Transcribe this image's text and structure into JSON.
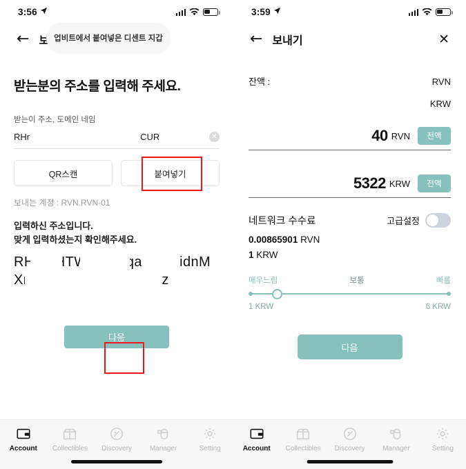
{
  "left": {
    "status": {
      "time": "3:56",
      "location_icon": "location-arrow-icon",
      "signal_icon": "cellular-bars-icon",
      "wifi_icon": "wifi-icon",
      "battery_icon": "battery-icon"
    },
    "nav": {
      "back_icon": "back-arrow-icon",
      "title": "보내기"
    },
    "toast": {
      "text": "업비트에서 붙여넣은 디센트 지갑"
    },
    "heading": "받는분의 주소를 입력해 주세요.",
    "field": {
      "label": "받는이 주소, 도메인 네임",
      "value": "RHr",
      "suffix": "CUR",
      "clear_icon": "clear-circle-icon",
      "clear_glyph": "✕"
    },
    "buttons": {
      "qr_scan": "QR스캔",
      "paste": "붙여넣기"
    },
    "account_line": "보내는 계정 : RVN.RVN-01",
    "confirm_line_1": "입력하신 주소입니다.",
    "confirm_line_2": "맞게 입력하셨는지 확인해주세요.",
    "address_text": "RHr9nHTWyx2SxqaRs34 idnMXrtgnBxvqF2hk?C URvz",
    "next_button": "다음",
    "highlights": [
      "paste-button",
      "next-button"
    ]
  },
  "right": {
    "status": {
      "time": "3:59",
      "location_icon": "location-arrow-icon",
      "signal_icon": "cellular-bars-icon",
      "wifi_icon": "wifi-icon",
      "battery_icon": "battery-icon"
    },
    "nav": {
      "back_icon": "back-arrow-icon",
      "title": "보내기",
      "close_icon": "close-icon",
      "close_glyph": "✕"
    },
    "balance": {
      "label": "잔액 :",
      "coin_value": "",
      "coin_unit": "RVN",
      "fiat_value": "",
      "fiat_unit": "KRW"
    },
    "amount_coin": {
      "value": "40",
      "unit": "RVN",
      "max_button": "전액"
    },
    "amount_fiat": {
      "value": "5322",
      "unit": "KRW",
      "max_button": "전액"
    },
    "fee": {
      "title": "네트워크 수수료",
      "advanced_label": "고급설정",
      "advanced_on": false,
      "coin_value": "0.00865901",
      "coin_unit": "RVN",
      "fiat_value": "1",
      "fiat_unit": "KRW"
    },
    "slider": {
      "label_slow": "매우느림",
      "label_normal": "보통",
      "label_fast": "빠름",
      "value_min": "1 KRW",
      "value_max": "6 KRW",
      "position_percent": 12
    },
    "next_button": "다음"
  },
  "tabbar": {
    "items": [
      {
        "label": "Account",
        "icon": "wallet-icon",
        "active": true
      },
      {
        "label": "Collectibles",
        "icon": "gift-box-icon",
        "active": false
      },
      {
        "label": "Discovery",
        "icon": "compass-icon",
        "active": false
      },
      {
        "label": "Manager",
        "icon": "mouse-icon",
        "active": false
      },
      {
        "label": "Setting",
        "icon": "gear-icon",
        "active": false
      }
    ]
  },
  "colors": {
    "accent_teal": "#86c1bb",
    "highlight_red": "#f4131c",
    "tabbar_bg": "#f7f7f7",
    "toast_bg": "#f7f7f7"
  }
}
